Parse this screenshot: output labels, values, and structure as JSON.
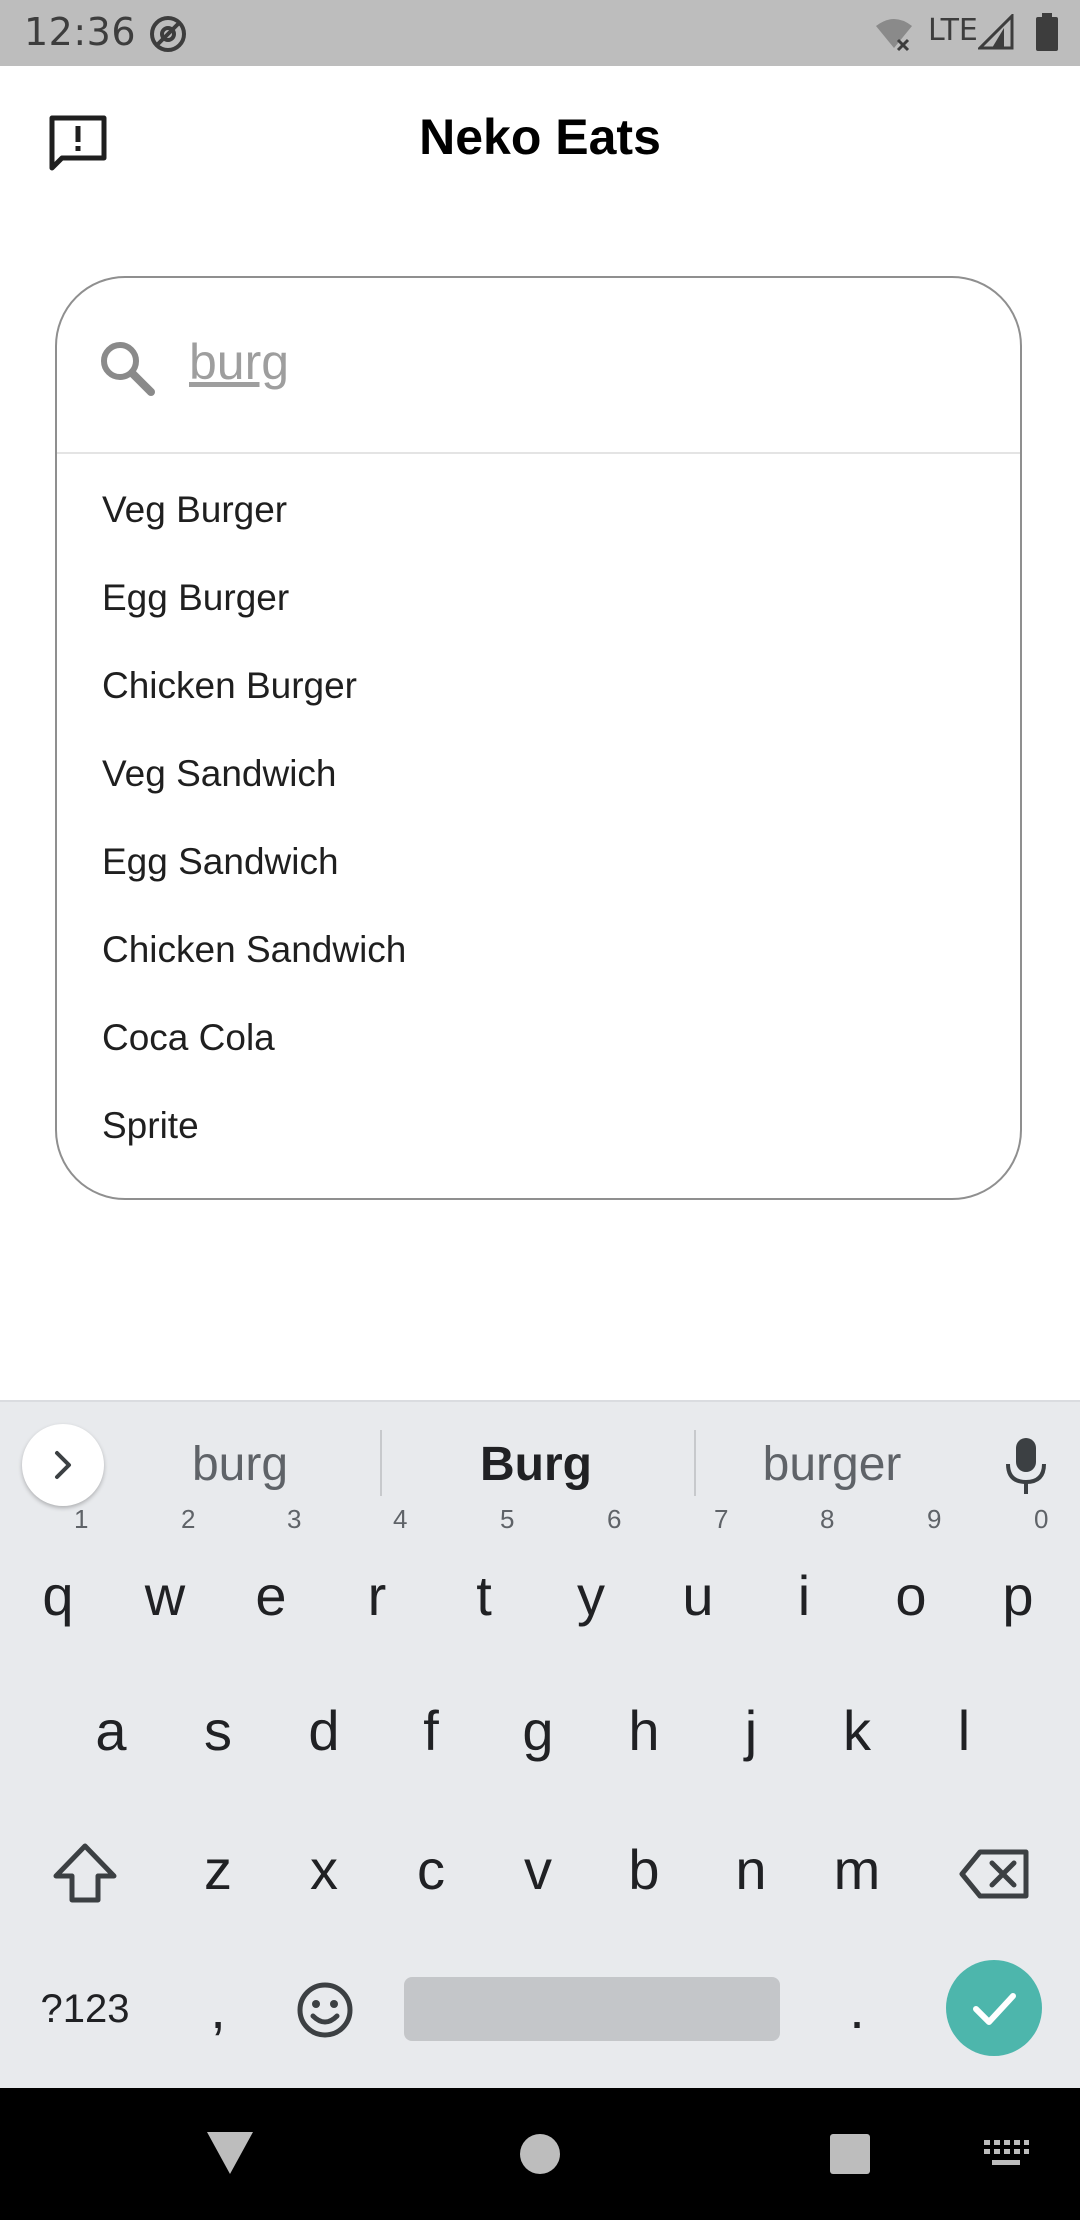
{
  "status_bar": {
    "time": "12:36",
    "network": "LTE"
  },
  "app": {
    "title": "Neko Eats"
  },
  "search": {
    "value": "burg",
    "suggestions": [
      "Veg Burger",
      "Egg Burger",
      "Chicken Burger",
      "Veg Sandwich",
      "Egg Sandwich",
      "Chicken Sandwich",
      "Coca Cola",
      "Sprite"
    ]
  },
  "keyboard": {
    "suggestions": [
      "burg",
      "Burg",
      "burger"
    ],
    "row1": [
      "q",
      "w",
      "e",
      "r",
      "t",
      "y",
      "u",
      "i",
      "o",
      "p"
    ],
    "row1_hints": [
      "1",
      "2",
      "3",
      "4",
      "5",
      "6",
      "7",
      "8",
      "9",
      "0"
    ],
    "row2": [
      "a",
      "s",
      "d",
      "f",
      "g",
      "h",
      "j",
      "k",
      "l"
    ],
    "row3": [
      "z",
      "x",
      "c",
      "v",
      "b",
      "n",
      "m"
    ],
    "symbols_label": "?123",
    "comma": ",",
    "period": "."
  },
  "colors": {
    "status_bar": "#bdbdbd",
    "keyboard_bg": "#e8eaed",
    "enter_key": "#4db6ac",
    "nav_bar": "#000000"
  },
  "icons": [
    "feedback-icon",
    "search-icon",
    "microphone-icon",
    "shift-icon",
    "backspace-icon",
    "emoji-icon",
    "checkmark-icon",
    "back-icon",
    "home-icon",
    "recents-icon",
    "keyboard-icon"
  ]
}
